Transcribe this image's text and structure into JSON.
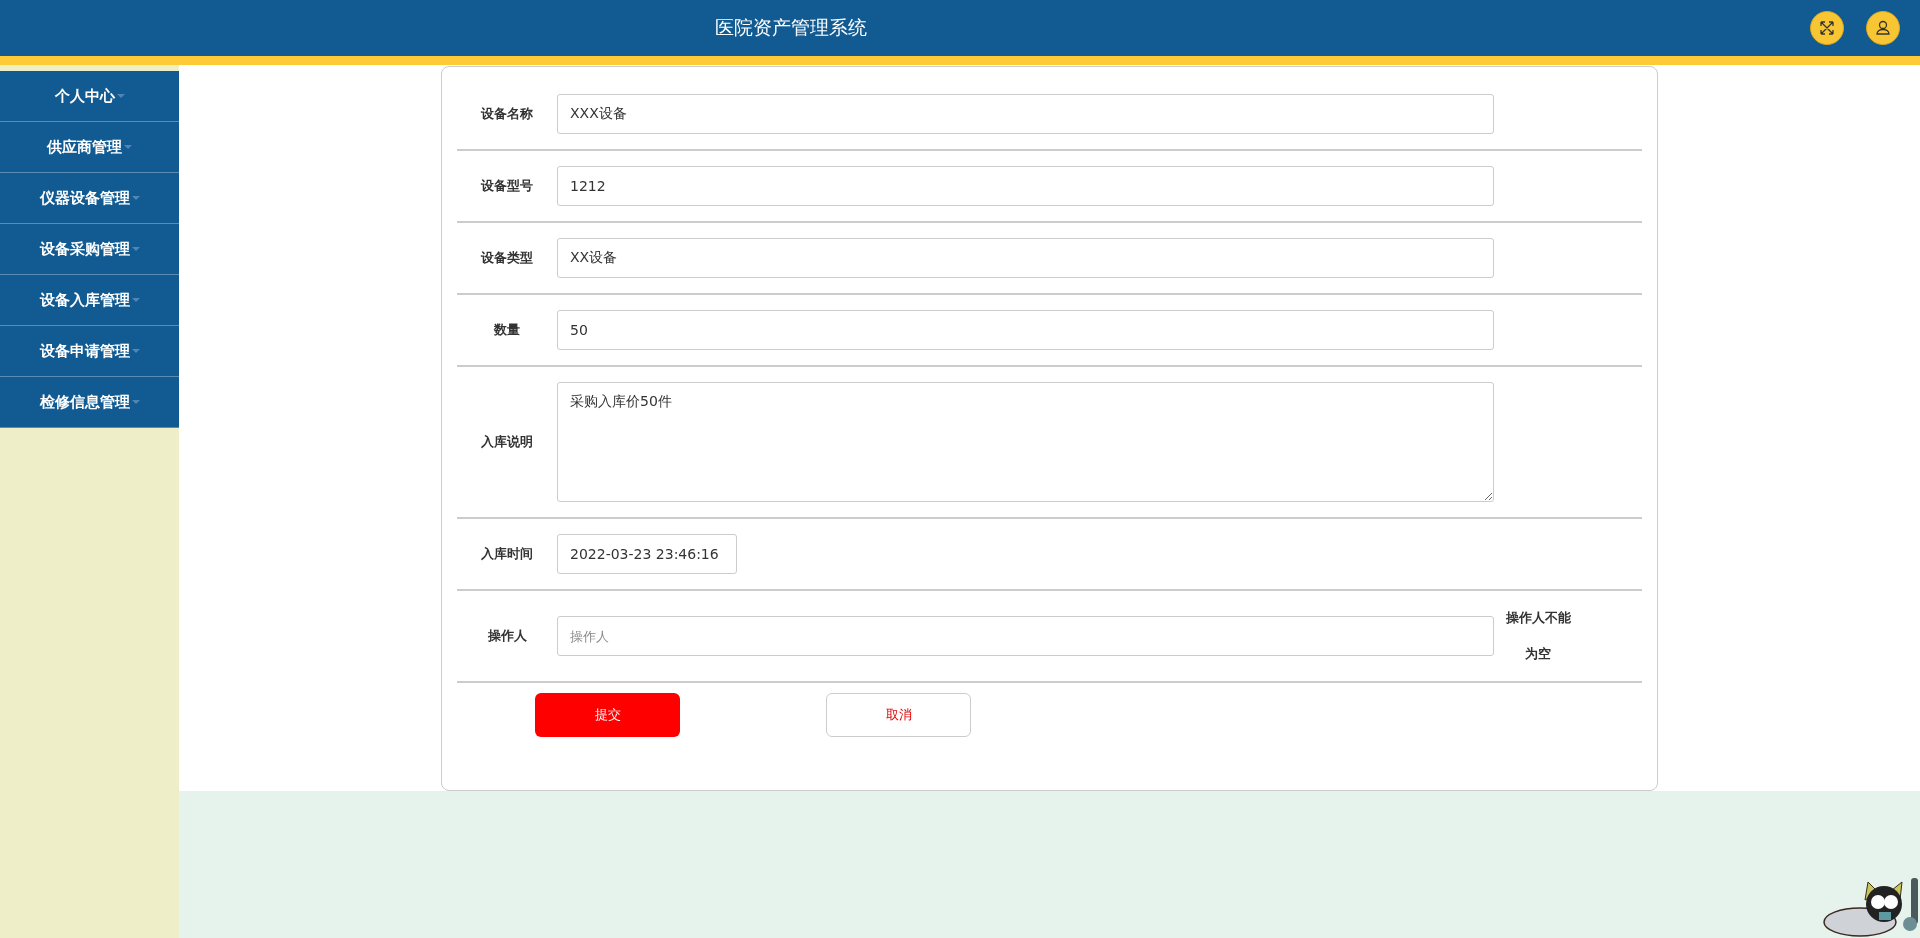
{
  "header": {
    "title": "医院资产管理系统"
  },
  "sidebar": {
    "items": [
      {
        "label": "个人中心"
      },
      {
        "label": "供应商管理"
      },
      {
        "label": "仪器设备管理"
      },
      {
        "label": "设备采购管理"
      },
      {
        "label": "设备入库管理"
      },
      {
        "label": "设备申请管理"
      },
      {
        "label": "检修信息管理"
      }
    ]
  },
  "form": {
    "fields": [
      {
        "kind": "input",
        "label": "设备名称",
        "value": "XXX设备"
      },
      {
        "kind": "input",
        "label": "设备型号",
        "value": "1212"
      },
      {
        "kind": "input",
        "label": "设备类型",
        "value": "XX设备"
      },
      {
        "kind": "input",
        "label": "数量",
        "value": "50"
      },
      {
        "kind": "textarea",
        "label": "入库说明",
        "value": "采购入库价50件"
      },
      {
        "kind": "datetime",
        "label": "入库时间",
        "value": "2022-03-23 23:46:16"
      },
      {
        "kind": "input",
        "label": "操作人",
        "placeholder": "操作人",
        "error": "操作人不能为空"
      }
    ],
    "buttons": [
      {
        "kind": "primary",
        "label": "提交"
      },
      {
        "kind": "secondary",
        "label": "取消"
      }
    ]
  }
}
